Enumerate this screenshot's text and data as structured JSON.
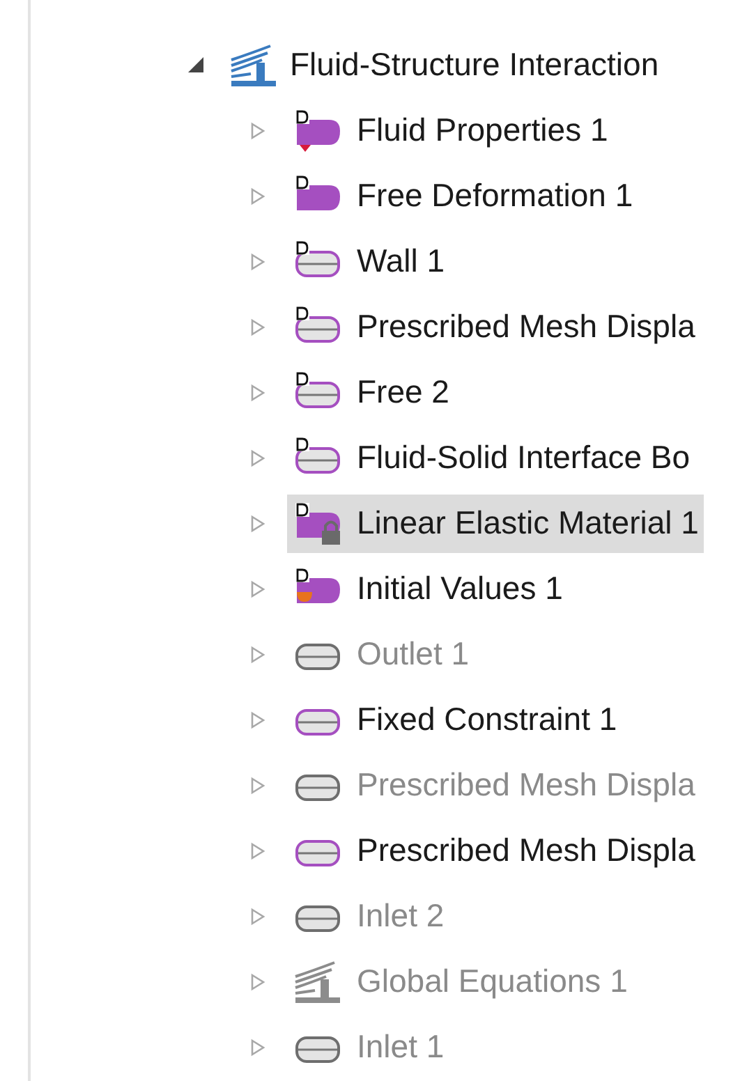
{
  "root": {
    "label": "Fluid-Structure Interaction",
    "expanded": true,
    "children": [
      {
        "label": "Fluid Properties 1",
        "kind": "domain",
        "domain_tag": true,
        "marker": {
          "kind": "default"
        },
        "disabled": false,
        "selected": false
      },
      {
        "label": "Free Deformation 1",
        "kind": "domain",
        "domain_tag": true,
        "disabled": false,
        "selected": false
      },
      {
        "label": "Wall 1",
        "kind": "boundary",
        "domain_tag": true,
        "disabled": false,
        "selected": false
      },
      {
        "label": "Prescribed Mesh Displa",
        "kind": "boundary",
        "domain_tag": true,
        "disabled": false,
        "selected": false
      },
      {
        "label": "Free 2",
        "kind": "boundary",
        "domain_tag": true,
        "disabled": false,
        "selected": false
      },
      {
        "label": "Fluid-Solid Interface Bo",
        "kind": "boundary",
        "domain_tag": true,
        "disabled": false,
        "selected": false
      },
      {
        "label": "Linear Elastic Material 1",
        "kind": "domain",
        "domain_tag": true,
        "marker": {
          "kind": "lock"
        },
        "disabled": false,
        "selected": true
      },
      {
        "label": "Initial Values 1",
        "kind": "domain",
        "domain_tag": true,
        "marker": {
          "kind": "initial"
        },
        "disabled": false,
        "selected": false
      },
      {
        "label": "Outlet 1",
        "kind": "boundary",
        "domain_tag": false,
        "disabled": true,
        "selected": false
      },
      {
        "label": "Fixed Constraint 1",
        "kind": "boundary",
        "domain_tag": false,
        "disabled": false,
        "selected": false
      },
      {
        "label": "Prescribed Mesh Displa",
        "kind": "boundary",
        "domain_tag": false,
        "disabled": true,
        "selected": false
      },
      {
        "label": "Prescribed Mesh Displa",
        "kind": "boundary",
        "domain_tag": false,
        "disabled": false,
        "selected": false
      },
      {
        "label": "Inlet 2",
        "kind": "boundary",
        "domain_tag": false,
        "disabled": true,
        "selected": false
      },
      {
        "label": "Global Equations 1",
        "kind": "physics",
        "domain_tag": false,
        "disabled": true,
        "selected": false
      },
      {
        "label": "Inlet 1",
        "kind": "boundary",
        "domain_tag": false,
        "disabled": true,
        "selected": false
      }
    ]
  }
}
